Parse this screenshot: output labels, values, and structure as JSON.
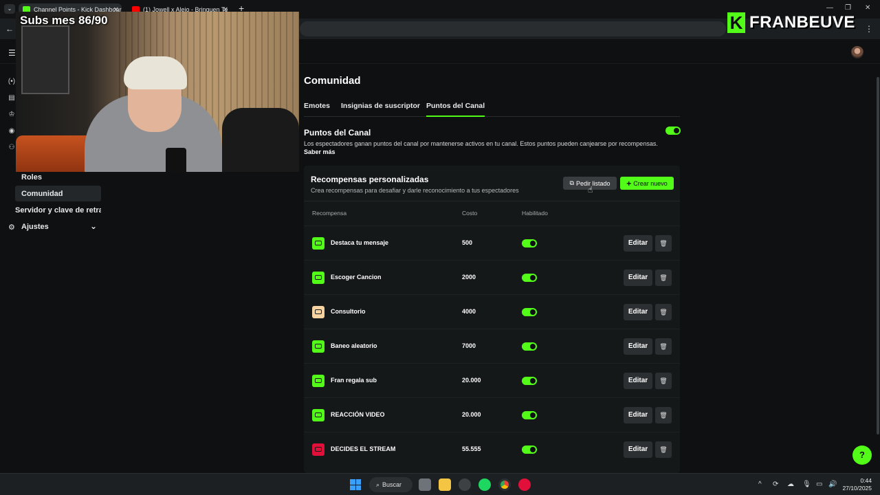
{
  "browser": {
    "tabs": [
      {
        "label": "Channel Points - Kick Dashboard",
        "favicon_color": "#53fc18",
        "active": true
      },
      {
        "label": "(1) Jowell x Alejo - Brinquen Te",
        "favicon_color": "#ff0000",
        "active": false
      }
    ],
    "new_tab_symbol": "+"
  },
  "overlay": {
    "subs_text": "Subs mes 86/90",
    "brand_name": "FRANBEUVE"
  },
  "sidebar": {
    "items": [
      {
        "label": "Roles"
      },
      {
        "label": "Comunidad"
      },
      {
        "label": "Servidor y clave de retrans"
      },
      {
        "label": "Ajustes"
      }
    ]
  },
  "page": {
    "title": "Comunidad",
    "tabs": [
      {
        "label": "Emotes"
      },
      {
        "label": "Insignias de suscriptor"
      },
      {
        "label": "Puntos del Canal"
      }
    ],
    "section": {
      "title": "Puntos del Canal",
      "description": "Los espectadores ganan puntos del canal por mantenerse activos en tu canal. Estos puntos pueden canjearse por recompensas.",
      "learn_more": "Saber más",
      "enabled": true
    },
    "rewards_panel": {
      "title": "Recompensas personalizadas",
      "description": "Crea recompensas para desafiar y darle reconocimiento a tus espectadores",
      "request_list_button": "Pedir listado",
      "create_button": "Crear nuevo",
      "columns": [
        "Recompensa",
        "Costo",
        "Habilitado"
      ],
      "edit_label": "Editar",
      "rows": [
        {
          "name": "Destaca tu mensaje",
          "cost": "500",
          "enabled": true,
          "icon_color": "#53fc18"
        },
        {
          "name": "Escoger Cancion",
          "cost": "2000",
          "enabled": true,
          "icon_color": "#53fc18"
        },
        {
          "name": "Consultorio",
          "cost": "4000",
          "enabled": true,
          "icon_color": "#f6d3a1"
        },
        {
          "name": "Baneo aleatorio",
          "cost": "7000",
          "enabled": true,
          "icon_color": "#53fc18"
        },
        {
          "name": "Fran regala sub",
          "cost": "20.000",
          "enabled": true,
          "icon_color": "#53fc18"
        },
        {
          "name": "REACCIÓN VIDEO",
          "cost": "20.000",
          "enabled": true,
          "icon_color": "#53fc18"
        },
        {
          "name": "DECIDES EL STREAM",
          "cost": "55.555",
          "enabled": true,
          "icon_color": "#e0103a"
        }
      ]
    }
  },
  "taskbar": {
    "search_label": "Buscar",
    "time": "0:44",
    "date": "27/10/2025"
  },
  "colors": {
    "accent": "#53fc18",
    "background": "#0e1011",
    "panel": "#151819"
  }
}
